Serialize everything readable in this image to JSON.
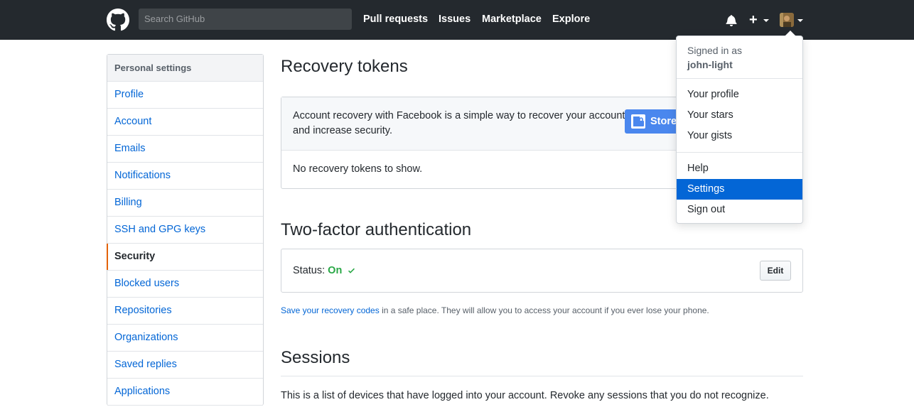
{
  "header": {
    "search_placeholder": "Search GitHub",
    "nav": [
      "Pull requests",
      "Issues",
      "Marketplace",
      "Explore"
    ],
    "plus_label": "+"
  },
  "sidebar": {
    "title": "Personal settings",
    "items": [
      {
        "label": "Profile"
      },
      {
        "label": "Account"
      },
      {
        "label": "Emails"
      },
      {
        "label": "Notifications"
      },
      {
        "label": "Billing"
      },
      {
        "label": "SSH and GPG keys"
      },
      {
        "label": "Security",
        "selected": true
      },
      {
        "label": "Blocked users"
      },
      {
        "label": "Repositories"
      },
      {
        "label": "Organizations"
      },
      {
        "label": "Saved replies"
      },
      {
        "label": "Applications"
      }
    ]
  },
  "recovery": {
    "title": "Recovery tokens",
    "description_line1": "Account recovery with Facebook is a simple way to recover your account",
    "description_line2": "and increase security.",
    "store_button": "Store",
    "empty_text": "No recovery tokens to show."
  },
  "two_factor": {
    "title": "Two-factor authentication",
    "status_label": "Status:",
    "status_value": "On",
    "edit_button": "Edit",
    "note_link": "Save your recovery codes",
    "note_text": " in a safe place. They will allow you to access your account if you ever lose your phone."
  },
  "sessions": {
    "title": "Sessions",
    "description": "This is a list of devices that have logged into your account. Revoke any sessions that you do not recognize."
  },
  "user_menu": {
    "signed_in_as": "Signed in as",
    "username": "john-light",
    "items_group1": [
      "Your profile",
      "Your stars",
      "Your gists"
    ],
    "items_group2": [
      "Help",
      "Settings",
      "Sign out"
    ],
    "active_item": "Settings"
  },
  "colors": {
    "header_bg": "#24292e",
    "link": "#0366d6",
    "status_on": "#28a745",
    "selected_border": "#e36209",
    "store_button_bg": "#4a87ee"
  }
}
